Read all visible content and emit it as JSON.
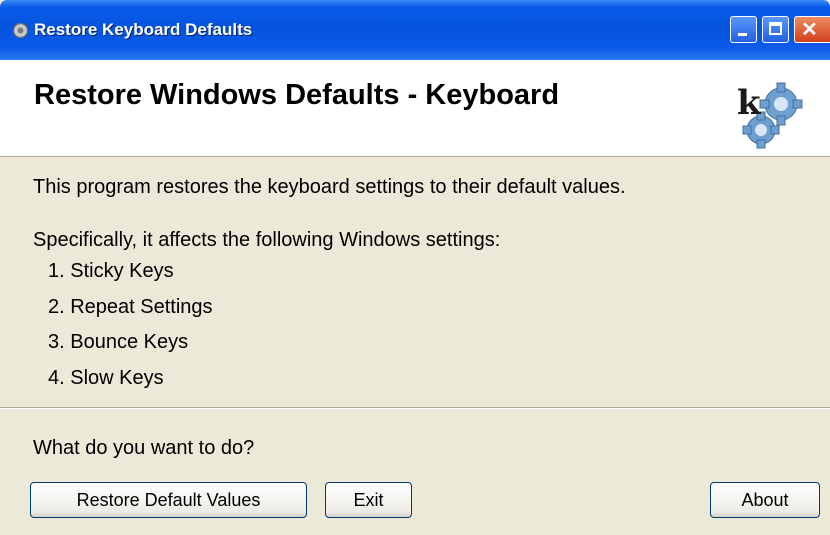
{
  "window": {
    "title": "Restore Keyboard Defaults",
    "controls": [
      "minimize",
      "maximize",
      "close"
    ]
  },
  "header": {
    "title": "Restore Windows Defaults - Keyboard",
    "logo_letter": "k",
    "logo_icon": "gears-logo"
  },
  "content": {
    "description": "This program restores the keyboard settings to their default values.",
    "intro": "Specifically, it affects the following Windows settings:",
    "settings": [
      "1. Sticky Keys",
      "2. Repeat Settings",
      "3. Bounce Keys",
      "4. Slow Keys"
    ]
  },
  "prompt": "What do you want to do?",
  "buttons": {
    "restore": "Restore Default Values",
    "exit": "Exit",
    "about": "About"
  },
  "colors": {
    "titlebar": "#0554e0",
    "dialog_background": "#ece9d8",
    "header_background": "#ffffff",
    "close_button": "#d2401c"
  }
}
